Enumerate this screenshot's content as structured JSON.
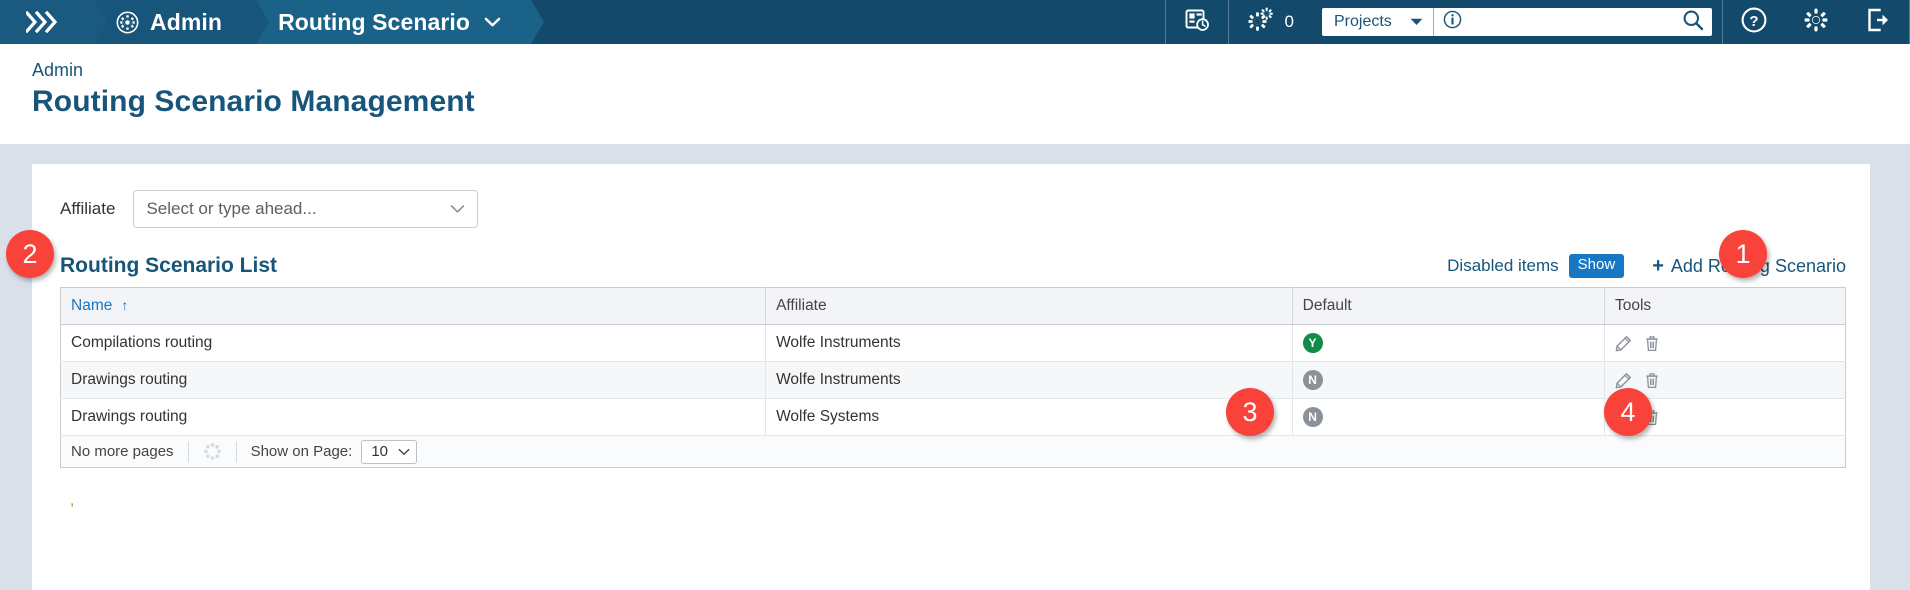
{
  "topnav": {
    "home_icon": "chevrons-logo",
    "admin_icon": "gear-circle-icon",
    "admin_label": "Admin",
    "current_label": "Routing Scenario",
    "current_caret": "chevron-down-icon",
    "calendar_icon": "calendar-clock-icon",
    "gears_icon": "gears-icon",
    "gears_count": "0",
    "search_scope": "Projects",
    "search_scope_caret": "caret-down-icon",
    "search_info_icon": "info-circle-icon",
    "search_value": "",
    "search_placeholder": "",
    "search_icon": "magnifier-icon",
    "help_icon": "question-circle-icon",
    "settings_icon": "gear-icon",
    "logout_icon": "logout-icon"
  },
  "header": {
    "breadcrumb": "Admin",
    "title": "Routing Scenario Management"
  },
  "filter": {
    "label": "Affiliate",
    "placeholder": "Select or type ahead...",
    "value": "",
    "caret_icon": "chevron-down-icon"
  },
  "list": {
    "title": "Routing Scenario List",
    "disabled_items_label": "Disabled items",
    "disabled_items_toggle": "Show",
    "add_label": "Add Routing Scenario",
    "add_icon": "plus-icon",
    "columns": [
      "Name",
      "Affiliate",
      "Default",
      "Tools"
    ],
    "sort_column": "Name",
    "sort_direction": "ascending",
    "sort_icon": "arrow-up-icon",
    "rows": [
      {
        "name": "Compilations routing",
        "affiliate": "Wolfe Instruments",
        "default": "Y",
        "tools": [
          "edit-icon",
          "delete-icon"
        ]
      },
      {
        "name": "Drawings routing",
        "affiliate": "Wolfe Instruments",
        "default": "N",
        "tools": [
          "edit-icon",
          "delete-icon"
        ]
      },
      {
        "name": "Drawings routing",
        "affiliate": "Wolfe Systems",
        "default": "N",
        "tools": [
          "edit-icon",
          "delete-icon"
        ]
      }
    ],
    "footer": {
      "pages_status": "No more pages",
      "refresh_icon": "loading-dots-icon",
      "show_on_page_label": "Show on Page:",
      "show_on_page_value": "10",
      "show_on_page_caret": "chevron-down-icon"
    },
    "stray_text": ","
  },
  "annotations": [
    {
      "id": "1",
      "target": "add-routing-scenario-link"
    },
    {
      "id": "2",
      "target": "affiliate-filter"
    },
    {
      "id": "3",
      "target": "default-column"
    },
    {
      "id": "4",
      "target": "tools-column"
    }
  ],
  "colors": {
    "nav_bg": "#134a6b",
    "nav_accent": "#1b6288",
    "brand_blue": "#17557a",
    "link_blue": "#1877c4",
    "annotation_red": "#f9423a",
    "default_yes": "#0f8c47",
    "default_no": "#8b9198",
    "page_bg": "#d9e0ea"
  }
}
